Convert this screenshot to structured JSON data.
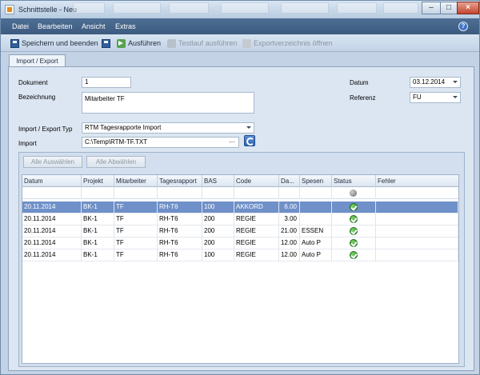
{
  "window": {
    "title": "Schnittstelle - Neu"
  },
  "menu": {
    "items": [
      "Datei",
      "Bearbeiten",
      "Ansicht",
      "Extras"
    ]
  },
  "toolbar": {
    "save_close": "Speichern und beenden",
    "run": "Ausführen",
    "test_run": "Testlauf ausführen",
    "open_export_dir": "Exportverzeichnis öffnen"
  },
  "tab": {
    "label": "Import / Export"
  },
  "form": {
    "dokument_label": "Dokument",
    "dokument_value": "1",
    "bezeichnung_label": "Bezeichnung",
    "bezeichnung_value": "Mitarbeiter TF",
    "datum_label": "Datum",
    "datum_value": "03.12.2014",
    "referenz_label": "Referenz",
    "referenz_value": "FU",
    "typ_label": "Import / Export Typ",
    "typ_value": "RTM Tagesrapporte Import",
    "import_label": "Import",
    "import_value": "C:\\Temp\\RTM-TF.TXT",
    "browse": "···"
  },
  "buttons": {
    "select_all": "Alle Auswählen",
    "deselect_all": "Alle Abwählen"
  },
  "grid": {
    "columns": [
      "Datum",
      "Projekt",
      "Mitarbeiter",
      "Tagesrapport",
      "BAS",
      "Code",
      "Da...",
      "Spesen",
      "Status",
      "Fehler"
    ],
    "rows": [
      {
        "datum": "20.11.2014",
        "projekt": "BK-1",
        "mitarbeiter": "TF",
        "tagesrapport": "RH-T6",
        "bas": "100",
        "code": "AKKORD",
        "da": "6.00",
        "spesen": "",
        "status": "ok",
        "fehler": "",
        "selected": true
      },
      {
        "datum": "20.11.2014",
        "projekt": "BK-1",
        "mitarbeiter": "TF",
        "tagesrapport": "RH-T6",
        "bas": "200",
        "code": "REGIE",
        "da": "3.00",
        "spesen": "",
        "status": "ok",
        "fehler": "",
        "selected": false
      },
      {
        "datum": "20.11.2014",
        "projekt": "BK-1",
        "mitarbeiter": "TF",
        "tagesrapport": "RH-T6",
        "bas": "200",
        "code": "REGIE",
        "da": "21.00",
        "spesen": "ESSEN",
        "status": "ok",
        "fehler": "",
        "selected": false
      },
      {
        "datum": "20.11.2014",
        "projekt": "BK-1",
        "mitarbeiter": "TF",
        "tagesrapport": "RH-T6",
        "bas": "200",
        "code": "REGIE",
        "da": "12.00",
        "spesen": "Auto P",
        "status": "ok",
        "fehler": "",
        "selected": false
      },
      {
        "datum": "20.11.2014",
        "projekt": "BK-1",
        "mitarbeiter": "TF",
        "tagesrapport": "RH-T6",
        "bas": "100",
        "code": "REGIE",
        "da": "12.00",
        "spesen": "Auto P",
        "status": "ok",
        "fehler": "",
        "selected": false
      }
    ]
  },
  "colors": {
    "menubar": "#4e6e94",
    "selected_row": "#6f90c8",
    "status_ok": "#2f8c2b"
  }
}
